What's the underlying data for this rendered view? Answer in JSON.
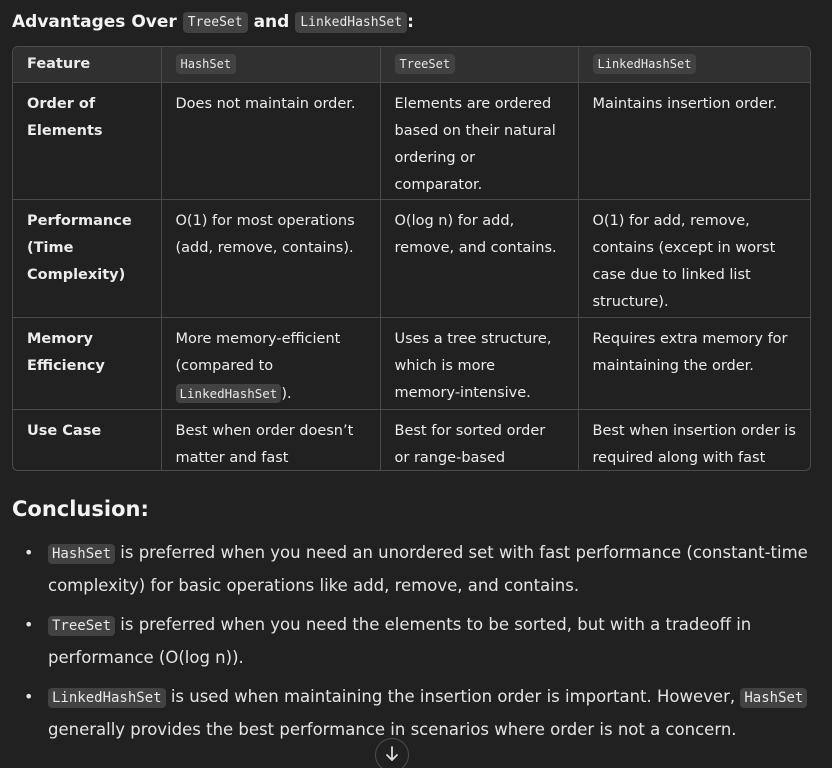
{
  "heading": {
    "prefix": "Advantages Over",
    "code1": "TreeSet",
    "middle": "and",
    "code2": "LinkedHashSet",
    "suffix": ":"
  },
  "table": {
    "headers": [
      "Feature",
      "HashSet",
      "TreeSet",
      "LinkedHashSet"
    ],
    "rows": [
      {
        "feature": "Order of Elements",
        "hashset": "Does not maintain order.",
        "treeset": "Elements are ordered based on their natural ordering or comparator.",
        "linkedhashset": "Maintains insertion order."
      },
      {
        "feature": "Performance (Time Complexity)",
        "hashset": "O(1) for most operations (add, remove, contains).",
        "treeset": "O(log n) for add, remove, and contains.",
        "linkedhashset": "O(1) for add, remove, contains (except in worst case due to linked list structure)."
      },
      {
        "feature": "Memory Efficiency",
        "hashset_pre": "More memory-efficient (compared to",
        "hashset_code": "LinkedHashSet",
        "hashset_post": ").",
        "treeset": "Uses a tree structure, which is more memory-intensive.",
        "linkedhashset": "Requires extra memory for maintaining the order."
      },
      {
        "feature": "Use Case",
        "hashset": "Best when order doesn’t matter and fast performance is required.",
        "treeset": "Best for sorted order or range-based operations.",
        "linkedhashset": "Best when insertion order is required along with fast performance."
      }
    ]
  },
  "conclusion": {
    "title": "Conclusion:",
    "bullet1": {
      "code": "HashSet",
      "text": "is preferred when you need an unordered set with fast performance (constant-time complexity) for basic operations like add, remove, and contains."
    },
    "bullet2": {
      "code": "TreeSet",
      "text": "is preferred when you need the elements to be sorted, but with a tradeoff in performance (O(log n))."
    },
    "bullet3": {
      "code": "LinkedHashSet",
      "text_mid": "is used when maintaining the insertion order is important. However,",
      "code2": "HashSet",
      "text_end": "generally provides the best performance in scenarios where order is not a concern."
    }
  },
  "icons": {
    "scroll": "arrow-down-icon"
  },
  "colors": {
    "background": "#212121",
    "code_background": "#424242",
    "table_header": "#303030",
    "border": "#4a4a4a",
    "text": "#ececec"
  }
}
